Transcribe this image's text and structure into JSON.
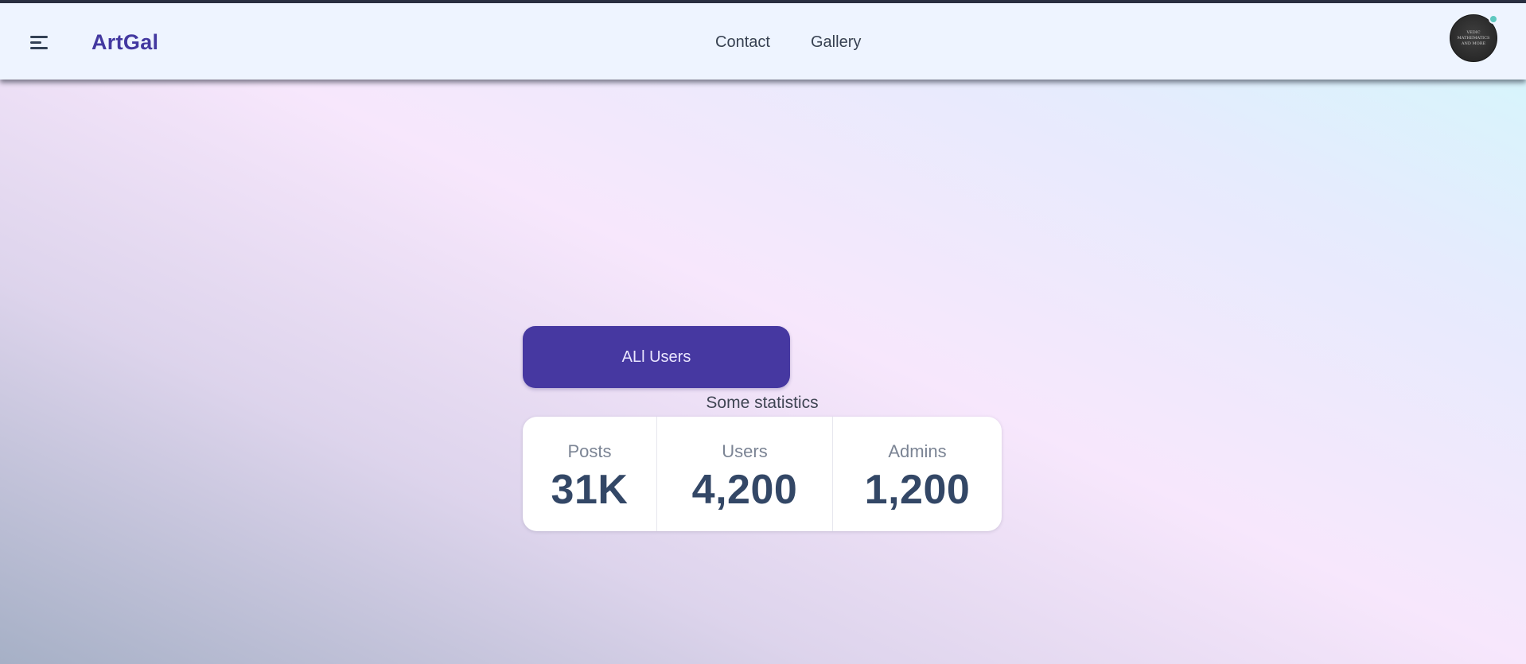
{
  "navbar": {
    "menu_icon": "hamburger-menu-icon",
    "brand": "ArtGal",
    "links": [
      {
        "label": "Contact"
      },
      {
        "label": "Gallery"
      }
    ],
    "avatar": {
      "logo_lines": [
        "VEDIC",
        "MATHEMATICS",
        "AND MORE"
      ],
      "status_color": "#5ec8c0"
    }
  },
  "main": {
    "all_users_button": "ALl Users",
    "stats_caption": "Some statistics",
    "stats": [
      {
        "title": "Posts",
        "value": "31K"
      },
      {
        "title": "Users",
        "value": "4,200"
      },
      {
        "title": "Admins",
        "value": "1,200"
      }
    ]
  },
  "colors": {
    "brand": "#4338a0",
    "button": "#4638a1",
    "stat_value": "#334766"
  }
}
